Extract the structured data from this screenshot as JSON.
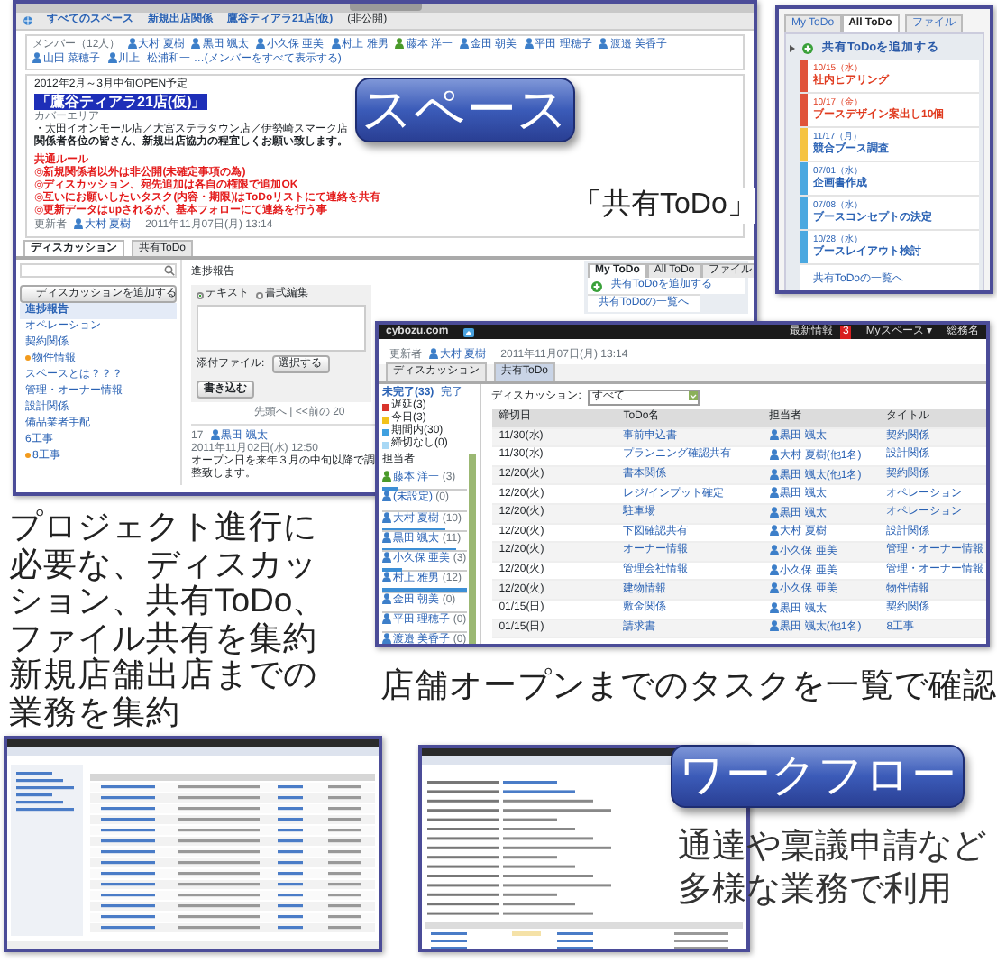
{
  "space_window": {
    "breadcrumb": [
      "すべてのスペース",
      "新規出店関係",
      "鷹谷ティアラ21店(仮)"
    ],
    "privacy": "(非公開)",
    "members_label": "メンバー（12人）",
    "members": [
      {
        "name": "大村 夏樹",
        "color": "#3d7fc9"
      },
      {
        "name": "黒田 颯太",
        "color": "#3d7fc9"
      },
      {
        "name": "小久保 亜美",
        "color": "#3d7fc9"
      },
      {
        "name": "村上 雅男",
        "color": "#3d7fc9"
      },
      {
        "name": "藤本 洋一",
        "color": "#4a9a2a"
      },
      {
        "name": "金田 朝美",
        "color": "#3d7fc9"
      },
      {
        "name": "平田 理穂子",
        "color": "#3d7fc9"
      },
      {
        "name": "渡邉 美香子",
        "color": "#3d7fc9"
      },
      {
        "name": "山田 菜穂子",
        "color": "#3d7fc9"
      },
      {
        "name": "川上",
        "color": "#3d7fc9"
      }
    ],
    "members_more": "松浦和一 …(メンバーをすべて表示する)",
    "schedule": "2012年2月～3月中旬OPEN予定",
    "space_title": "「鷹谷ティアラ21店(仮)」",
    "cover_label": "カバーエリア",
    "cover_stores": "・太田イオンモール店／大宮ステラタウン店／伊勢崎スマーク店",
    "greeting": "関係者各位の皆さん、新規出店協力の程宜しくお願い致します。",
    "rules": [
      "共通ルール",
      "◎新規関係者以外は非公開(未確定事項の為)",
      "◎ディスカッション、宛先追加は各自の権限で追加OK",
      "◎互いにお願いしたいタスク(内容・期限)はToDoリストにて連絡を共有",
      "◎更新データはupされるが、基本フォローにて連絡を行う事"
    ],
    "updater_label": "更新者",
    "updater": "大村 夏樹",
    "updated_at": "2011年11月07日(月) 13:14",
    "tabs": [
      {
        "label": "ディスカッション",
        "selected": true
      },
      {
        "label": "共有ToDo",
        "selected": false
      }
    ],
    "add_discussion": "ディスカッションを追加する",
    "discussions": [
      {
        "label": "進捗報告",
        "selected": true,
        "marked": false
      },
      {
        "label": "オペレーション",
        "selected": false,
        "marked": false
      },
      {
        "label": "契約関係",
        "selected": false,
        "marked": false
      },
      {
        "label": "物件情報",
        "selected": false,
        "marked": true
      },
      {
        "label": "スペースとは？？？",
        "selected": false,
        "marked": false
      },
      {
        "label": "管理・オーナー情報",
        "selected": false,
        "marked": false
      },
      {
        "label": "設計関係",
        "selected": false,
        "marked": false
      },
      {
        "label": "備品業者手配",
        "selected": false,
        "marked": false
      },
      {
        "label": "6工事",
        "selected": false,
        "marked": false
      },
      {
        "label": "8工事",
        "selected": false,
        "marked": true
      }
    ],
    "thread_title": "進捗報告",
    "editor_modes": [
      {
        "label": "テキスト",
        "selected": true
      },
      {
        "label": "書式編集",
        "selected": false
      }
    ],
    "attach_label": "添付ファイル:",
    "choose_button": "選択する",
    "post_button": "書き込む",
    "pager": "先頭へ | <<前の 20",
    "comment": {
      "number": "17",
      "author": "黒田 颯太",
      "date": "2011年11月02日(水) 12:50",
      "text": "オープン日を来年３月の中旬以降で調整致します。"
    },
    "todo_tabs": [
      {
        "label": "My ToDo",
        "selected": true
      },
      {
        "label": "All ToDo",
        "selected": false
      },
      {
        "label": "ファイル",
        "selected": false
      }
    ],
    "add_todo": "共有ToDoを追加する",
    "todo_list_link": "共有ToDoの一覧へ"
  },
  "space_banner": "スペース",
  "todo_caption": "「共有ToDo」",
  "todo_widget": {
    "tabs": [
      {
        "label": "My ToDo",
        "selected": false
      },
      {
        "label": "All ToDo",
        "selected": true
      },
      {
        "label": "ファイル",
        "selected": false
      }
    ],
    "add_todo": "共有ToDoを追加する",
    "items": [
      {
        "date": "10/15（水）",
        "title": "社内ヒアリング",
        "color": "#e0533a",
        "overdue": true
      },
      {
        "date": "10/17（金）",
        "title": "ブースデザイン案出し10個",
        "color": "#e0533a",
        "overdue": true
      },
      {
        "date": "11/17（月）",
        "title": "競合ブース調査",
        "color": "#f5c342",
        "overdue": false
      },
      {
        "date": "07/01（水）",
        "title": "企画書作成",
        "color": "#4aa8e0",
        "overdue": false
      },
      {
        "date": "07/08（水）",
        "title": "ブースコンセプトの決定",
        "color": "#4aa8e0",
        "overdue": false
      },
      {
        "date": "10/28（水）",
        "title": "ブースレイアウト検討",
        "color": "#4aa8e0",
        "overdue": false
      }
    ],
    "list_link": "共有ToDoの一覧へ"
  },
  "left_caption": [
    "プロジェクト進行に",
    "必要な、ディスカッ",
    "ション、共有ToDo、",
    "ファイル共有を集約",
    "新規店舗出店までの",
    "業務を集約"
  ],
  "todo_window": {
    "brand": "cybozu.com",
    "header_links": [
      "最新情報",
      "Myスペース ▾",
      "総務名"
    ],
    "notice_count": "3",
    "updater_label": "更新者",
    "updater": "大村 夏樹",
    "updated_at": "2011年11月07日(月) 13:14",
    "tabs": [
      {
        "label": "ディスカッション",
        "selected": false
      },
      {
        "label": "共有ToDo",
        "selected": true
      }
    ],
    "status_tabs": [
      {
        "label": "未完了(33)",
        "selected": true
      },
      {
        "label": "完了",
        "selected": false
      }
    ],
    "legend": [
      {
        "label": "遅延(3)",
        "color": "#d9342b"
      },
      {
        "label": "今日(3)",
        "color": "#f2c21b"
      },
      {
        "label": "期間内(30)",
        "color": "#3fa0e0"
      },
      {
        "label": "締切なし(0)",
        "color": "#a8d8f5"
      }
    ],
    "assignee_label": "担当者",
    "assignees": [
      {
        "name": "藤本 洋一",
        "count": "(3)",
        "level": 0.2,
        "color": "#4a9a2a"
      },
      {
        "name": "(未設定)",
        "count": "(0)",
        "color": "#3d7fc9"
      },
      {
        "name": "大村 夏樹",
        "count": "(10)",
        "level": 0.75,
        "color": "#3d7fc9"
      },
      {
        "name": "黒田 颯太",
        "count": "(11)",
        "level": 0.88,
        "color": "#3d7fc9"
      },
      {
        "name": "小久保 亜美",
        "count": "(3)",
        "level": 0.23,
        "color": "#3d7fc9"
      },
      {
        "name": "村上 雅男",
        "count": "(12)",
        "level": 1,
        "color": "#3d7fc9"
      },
      {
        "name": "金田 朝美",
        "count": "(0)",
        "color": "#3d7fc9"
      },
      {
        "name": "平田 理穂子",
        "count": "(0)",
        "color": "#3d7fc9"
      },
      {
        "name": "渡邉 美香子",
        "count": "(0)",
        "color": "#3d7fc9"
      }
    ],
    "filter_label": "ディスカッション:",
    "filter_value": "すべて",
    "columns": [
      "締切日",
      "ToDo名",
      "担当者",
      "タイトル"
    ],
    "rows": [
      [
        "11/30(水)",
        "事前申込書",
        "黒田 颯太",
        "契約関係"
      ],
      [
        "11/30(水)",
        "プランニング確認共有",
        "大村 夏樹(他1名)",
        "設計関係"
      ],
      [
        "12/20(火)",
        "書本関係",
        "黒田 颯太(他1名)",
        "契約関係"
      ],
      [
        "12/20(火)",
        "レジ/インプット確定",
        "黒田 颯太",
        "オペレーション"
      ],
      [
        "12/20(火)",
        "駐車場",
        "黒田 颯太",
        "オペレーション"
      ],
      [
        "12/20(火)",
        "下図確認共有",
        "大村 夏樹",
        "設計関係"
      ],
      [
        "12/20(火)",
        "オーナー情報",
        "小久保 亜美",
        "管理・オーナー情報"
      ],
      [
        "12/20(火)",
        "管理会社情報",
        "小久保 亜美",
        "管理・オーナー情報"
      ],
      [
        "12/20(火)",
        "建物情報",
        "小久保 亜美",
        "物件情報"
      ],
      [
        "01/15(日)",
        "敷金関係",
        "黒田 颯太",
        "契約関係"
      ],
      [
        "01/15(日)",
        "請求書",
        "黒田 颯太(他1名)",
        "8工事"
      ]
    ]
  },
  "todo_caption_2": "店舗オープンまでのタスクを一覧で確認",
  "workflow_banner": "ワークフロー",
  "workflow_caption": [
    "通達や稟議申請など",
    "多様な業務で利用"
  ]
}
